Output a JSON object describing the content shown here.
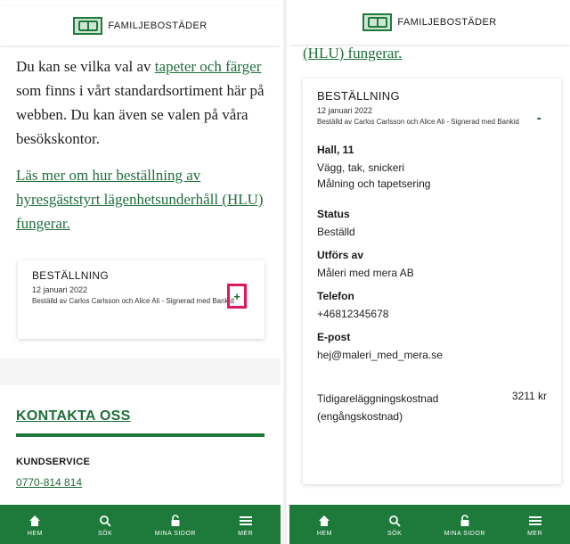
{
  "brand": {
    "name": "FAMILJEBOSTÄDER",
    "color": "#1e7a3a",
    "highlight": "#e0185a"
  },
  "left": {
    "intro_before": "Du kan se vilka val av ",
    "intro_link": "tapeter och färger",
    "intro_after": " som finns i vårt standardsortiment här på webben. Du kan även se valen på våra besökskontor.",
    "more_link": "Läs mer om hur beställning av hyresgäststyrt lägenhetsunderhåll (HLU) fungerar.",
    "card": {
      "title": "BESTÄLLNING",
      "date": "12 januari 2022",
      "meta": "Beställd av Carlos Carlsson och Alice Ali - Signerad med Bankid",
      "toggle": "+"
    },
    "contact": {
      "title": "KONTAKTA OSS",
      "service_label": "KUNDSERVICE",
      "phone": "0770-814 814"
    }
  },
  "right": {
    "top_link": "(HLU) fungerar.",
    "card": {
      "title": "BESTÄLLNING",
      "date": "12 januari 2022",
      "meta": "Beställd av Carlos Carlsson och Alice Ali - Signerad med Bankid",
      "toggle": "-",
      "room": "Hall, 11",
      "room_detail1": "Vägg, tak, snickeri",
      "room_detail2": "Målning och tapetsering",
      "status_label": "Status",
      "status_value": "Beställd",
      "performer_label": "Utförs av",
      "performer_value": "Måleri med mera AB",
      "phone_label": "Telefon",
      "phone_value": "+46812345678",
      "email_label": "E-post",
      "email_value": "hej@maleri_med_mera.se",
      "cost_label": "Tidigareläggningskostnad (engångskostnad)",
      "cost_value": "3211 kr"
    }
  },
  "nav": [
    {
      "label": "HEM",
      "icon": "home-icon"
    },
    {
      "label": "SÖK",
      "icon": "search-icon"
    },
    {
      "label": "MINA SIDOR",
      "icon": "lock-icon"
    },
    {
      "label": "MER",
      "icon": "menu-icon"
    }
  ]
}
